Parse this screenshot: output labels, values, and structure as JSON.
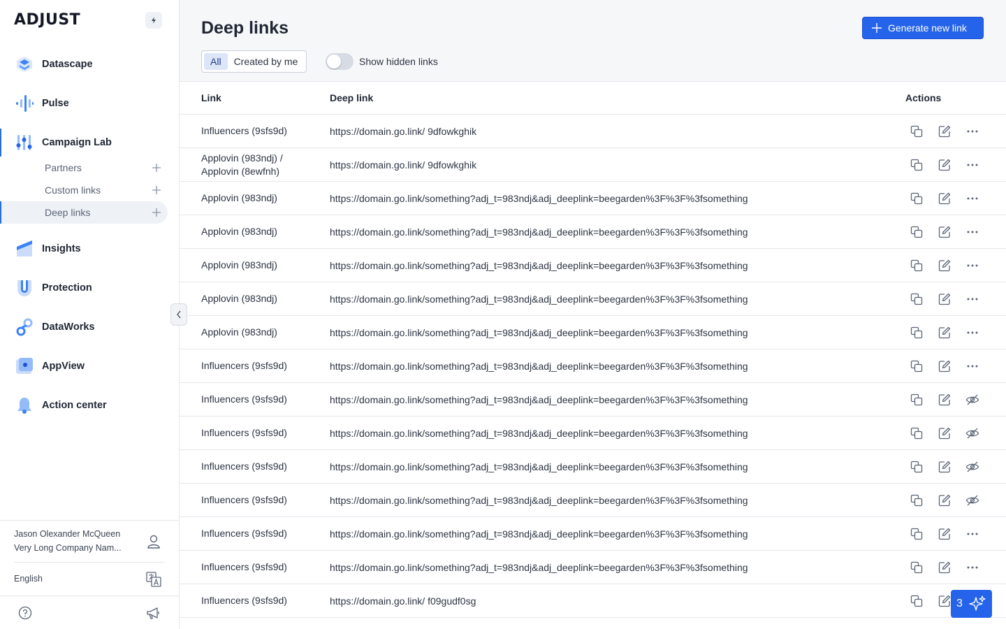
{
  "brand": {
    "logo_text": "ADJUST"
  },
  "sidebar": {
    "nav": [
      {
        "label": "Datascape",
        "icon": "datascape-icon"
      },
      {
        "label": "Pulse",
        "icon": "pulse-icon"
      },
      {
        "label": "Campaign Lab",
        "icon": "campaign-lab-icon"
      },
      {
        "label": "Insights",
        "icon": "insights-icon"
      },
      {
        "label": "Protection",
        "icon": "protection-icon"
      },
      {
        "label": "DataWorks",
        "icon": "dataworks-icon"
      },
      {
        "label": "AppView",
        "icon": "appview-icon"
      },
      {
        "label": "Action center",
        "icon": "bell-icon"
      }
    ],
    "sub_items": [
      {
        "label": "Partners"
      },
      {
        "label": "Custom links"
      },
      {
        "label": "Deep links"
      }
    ],
    "user": {
      "name": "Jason Olexander McQueen",
      "company": "Very Long Company Nam..."
    },
    "language": "English"
  },
  "header": {
    "title": "Deep links",
    "generate_button": "Generate new link",
    "filters": {
      "all": "All",
      "created_by_me": "Created by me"
    },
    "toggle_label": "Show hidden links"
  },
  "table": {
    "columns": {
      "link": "Link",
      "deep_link": "Deep link",
      "actions": "Actions"
    },
    "rows": [
      {
        "link": "Influencers (9sfs9d)",
        "deep_link": "https://domain.go.link/ 9dfowkghik",
        "third_action": "more"
      },
      {
        "link": "Applovin (983ndj) / Applovin (8ewfnh)",
        "deep_link": "https://domain.go.link/ 9dfowkghik",
        "third_action": "more"
      },
      {
        "link": "Applovin (983ndj)",
        "deep_link": "https://domain.go.link/something?adj_t=983ndj&adj_deeplink=beegarden%3F%3F%3fsomething",
        "third_action": "more"
      },
      {
        "link": "Applovin (983ndj)",
        "deep_link": "https://domain.go.link/something?adj_t=983ndj&adj_deeplink=beegarden%3F%3F%3fsomething",
        "third_action": "more"
      },
      {
        "link": "Applovin (983ndj)",
        "deep_link": "https://domain.go.link/something?adj_t=983ndj&adj_deeplink=beegarden%3F%3F%3fsomething",
        "third_action": "more"
      },
      {
        "link": "Applovin (983ndj)",
        "deep_link": "https://domain.go.link/something?adj_t=983ndj&adj_deeplink=beegarden%3F%3F%3fsomething",
        "third_action": "more"
      },
      {
        "link": "Applovin (983ndj)",
        "deep_link": "https://domain.go.link/something?adj_t=983ndj&adj_deeplink=beegarden%3F%3F%3fsomething",
        "third_action": "more"
      },
      {
        "link": "Influencers (9sfs9d)",
        "deep_link": "https://domain.go.link/something?adj_t=983ndj&adj_deeplink=beegarden%3F%3F%3fsomething",
        "third_action": "more"
      },
      {
        "link": "Influencers (9sfs9d)",
        "deep_link": "https://domain.go.link/something?adj_t=983ndj&adj_deeplink=beegarden%3F%3F%3fsomething",
        "third_action": "hidden"
      },
      {
        "link": "Influencers (9sfs9d)",
        "deep_link": "https://domain.go.link/something?adj_t=983ndj&adj_deeplink=beegarden%3F%3F%3fsomething",
        "third_action": "hidden"
      },
      {
        "link": "Influencers (9sfs9d)",
        "deep_link": "https://domain.go.link/something?adj_t=983ndj&adj_deeplink=beegarden%3F%3F%3fsomething",
        "third_action": "hidden"
      },
      {
        "link": "Influencers (9sfs9d)",
        "deep_link": "https://domain.go.link/something?adj_t=983ndj&adj_deeplink=beegarden%3F%3F%3fsomething",
        "third_action": "hidden"
      },
      {
        "link": "Influencers (9sfs9d)",
        "deep_link": "https://domain.go.link/something?adj_t=983ndj&adj_deeplink=beegarden%3F%3F%3fsomething",
        "third_action": "more"
      },
      {
        "link": "Influencers (9sfs9d)",
        "deep_link": "https://domain.go.link/something?adj_t=983ndj&adj_deeplink=beegarden%3F%3F%3fsomething",
        "third_action": "more"
      },
      {
        "link": "Influencers (9sfs9d)",
        "deep_link": "https://domain.go.link/ f09gudf0sg",
        "third_action": "more"
      }
    ]
  },
  "assistant": {
    "count": "3"
  },
  "colors": {
    "accent": "#2563eb",
    "active_bar": "#2a6fd9",
    "border": "#e3e6ec",
    "header_bg": "#f6f7f9"
  }
}
